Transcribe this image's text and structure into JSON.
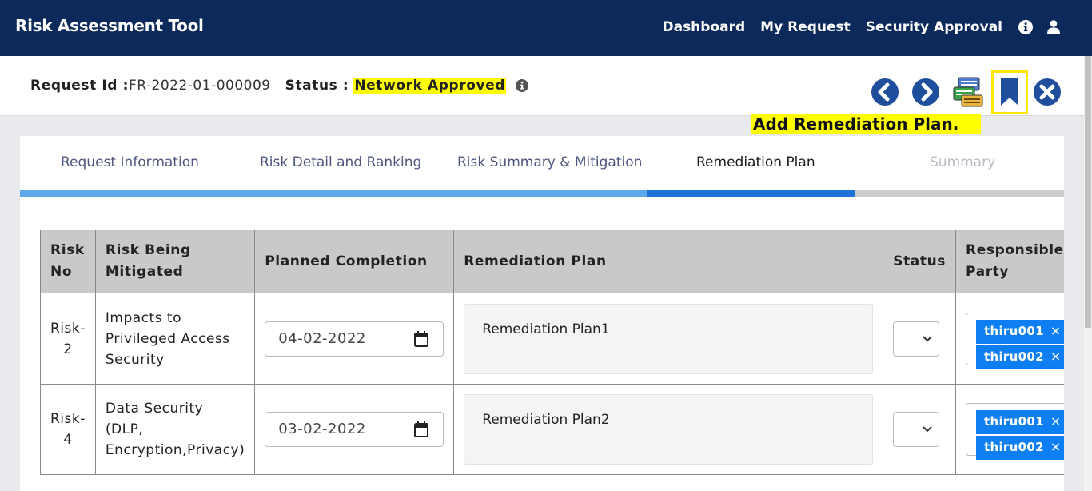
{
  "app": {
    "title": "Risk Assessment Tool"
  },
  "nav": {
    "items": [
      "Dashboard",
      "My Request",
      "Security Approval"
    ]
  },
  "request": {
    "id_label": "Request Id :",
    "id_value": "FR-2022-01-000009",
    "status_label": "Status :",
    "status_value": "Network Approved"
  },
  "tooltip": "Add Remediation Plan.",
  "tabs": [
    {
      "label": "Request Information",
      "state": "done"
    },
    {
      "label": "Risk Detail and Ranking",
      "state": "done"
    },
    {
      "label": "Risk Summary & Mitigation",
      "state": "done"
    },
    {
      "label": "Remediation Plan",
      "state": "active"
    },
    {
      "label": "Summary",
      "state": "disabled"
    }
  ],
  "colors": {
    "nav": "#0b2a5b",
    "progress_done": "#5fa8ec",
    "progress_active": "#1f73d6",
    "progress_todo": "#cccccc",
    "chip": "#0d7ff2",
    "highlight": "#ffff00"
  },
  "table": {
    "headers": {
      "risk_no": [
        "Risk",
        "No"
      ],
      "risk_mitigated": [
        "Risk Being",
        "Mitigated"
      ],
      "planned": "Planned Completion",
      "plan": "Remediation Plan",
      "status": "Status",
      "party": [
        "Responsible",
        "Party"
      ]
    },
    "rows": [
      {
        "risk_no": [
          "Risk-",
          "2"
        ],
        "risk_name": [
          "Impacts to",
          "Privileged Access",
          "Security"
        ],
        "date": "04-02-2022",
        "plan": "Remediation Plan1",
        "parties": [
          "thiru001",
          "thiru002"
        ]
      },
      {
        "risk_no": [
          "Risk-",
          "4"
        ],
        "risk_name": [
          "Data Security (DLP,",
          "Encryption,Privacy)"
        ],
        "date": "03-02-2022",
        "plan": "Remediation Plan2",
        "parties": [
          "thiru001",
          "thiru002"
        ]
      }
    ]
  }
}
